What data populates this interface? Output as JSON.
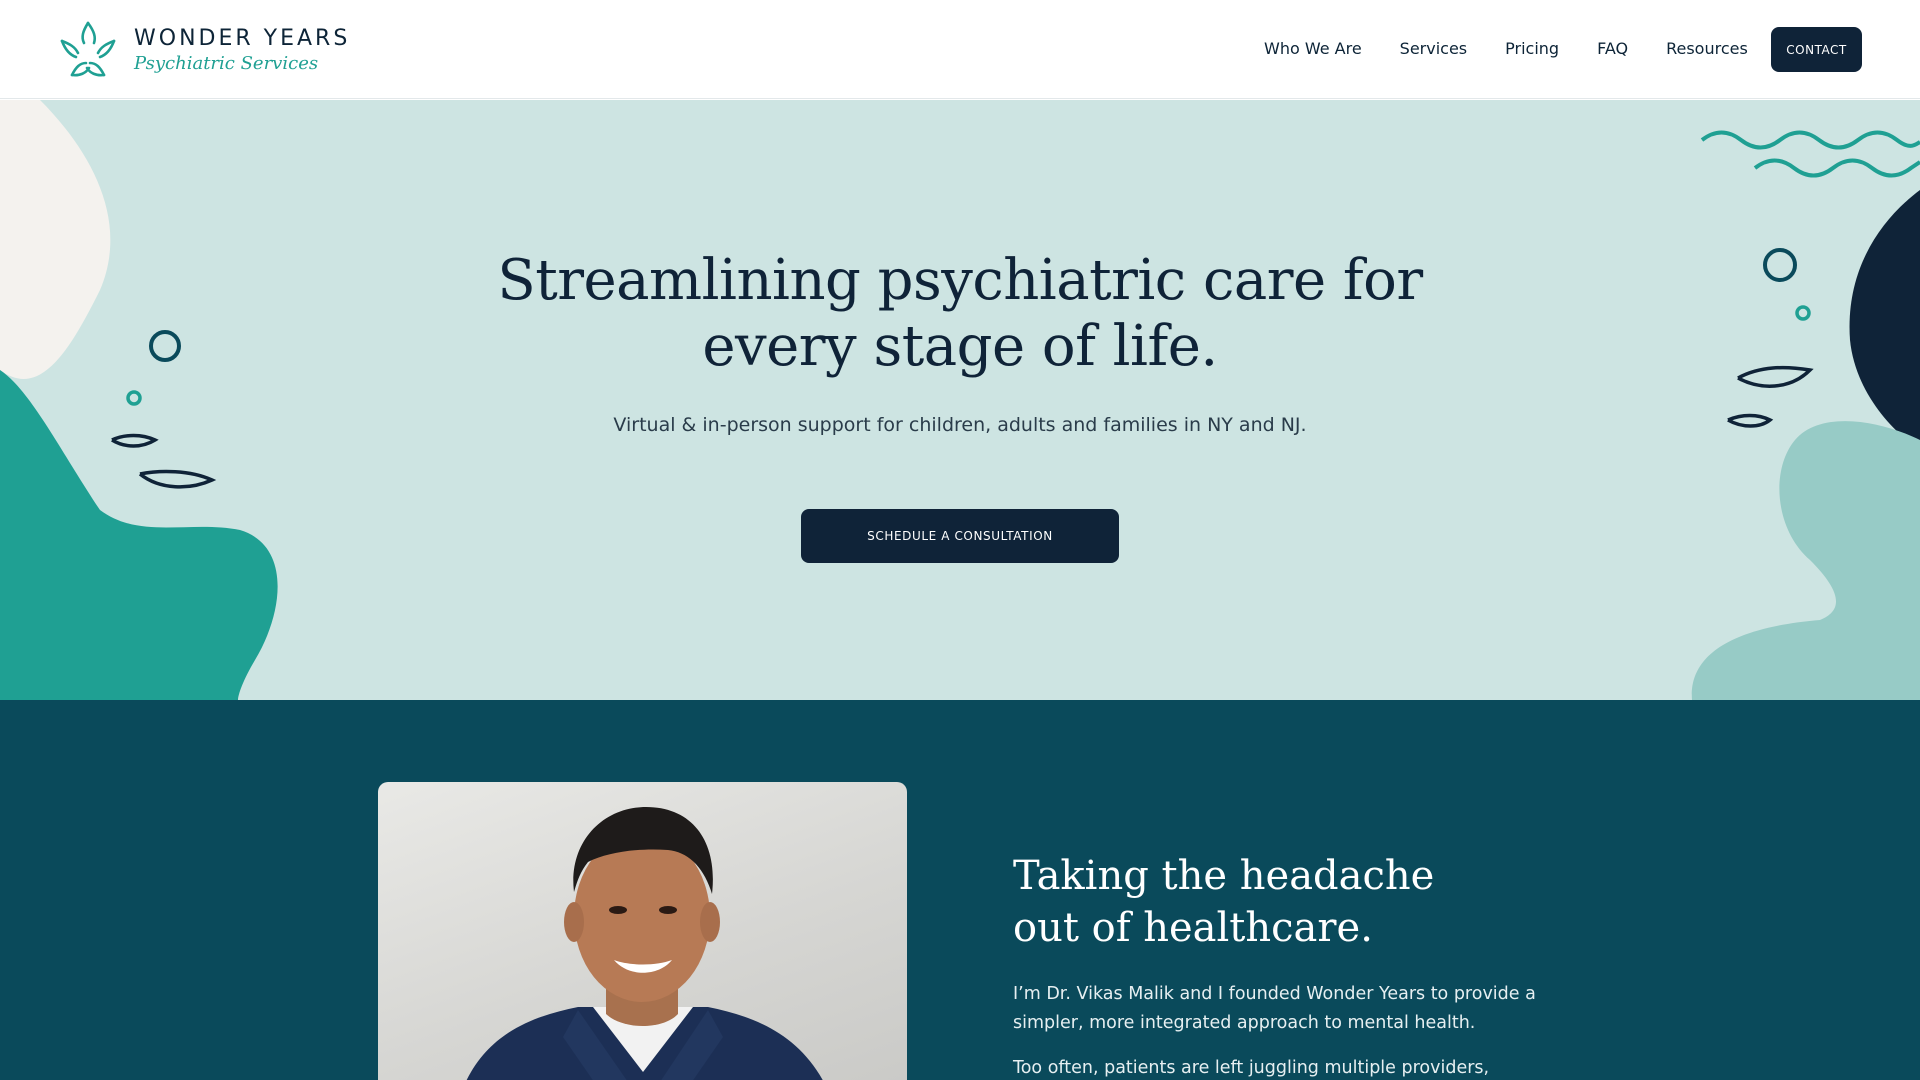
{
  "brand": {
    "name": "WONDER YEARS",
    "tagline": "Psychiatric Services"
  },
  "nav": {
    "items": [
      "Who We Are",
      "Services",
      "Pricing",
      "FAQ",
      "Resources"
    ],
    "contact_label": "CONTACT"
  },
  "hero": {
    "title_line1": "Streamlining psychiatric care for",
    "title_line2": "every stage of life.",
    "subtitle": "Virtual & in-person support for children, adults and families in NY and NJ.",
    "cta_label": "SCHEDULE A CONSULTATION"
  },
  "about": {
    "heading_line1": "Taking the headache",
    "heading_line2": "out of healthcare.",
    "paragraph1": "I’m Dr. Vikas Malik and I founded Wonder Years to provide a simpler, more integrated approach to mental health.",
    "paragraph2": "Too often, patients are left juggling multiple providers, referrals,"
  },
  "colors": {
    "navy": "#0f2338",
    "teal": "#1fa093",
    "hero_bg": "#cde4e2",
    "about_bg": "#0a4a5b",
    "light_teal": "#97cbc6"
  },
  "icons": {
    "logo": "star-wreath-logo-icon"
  }
}
